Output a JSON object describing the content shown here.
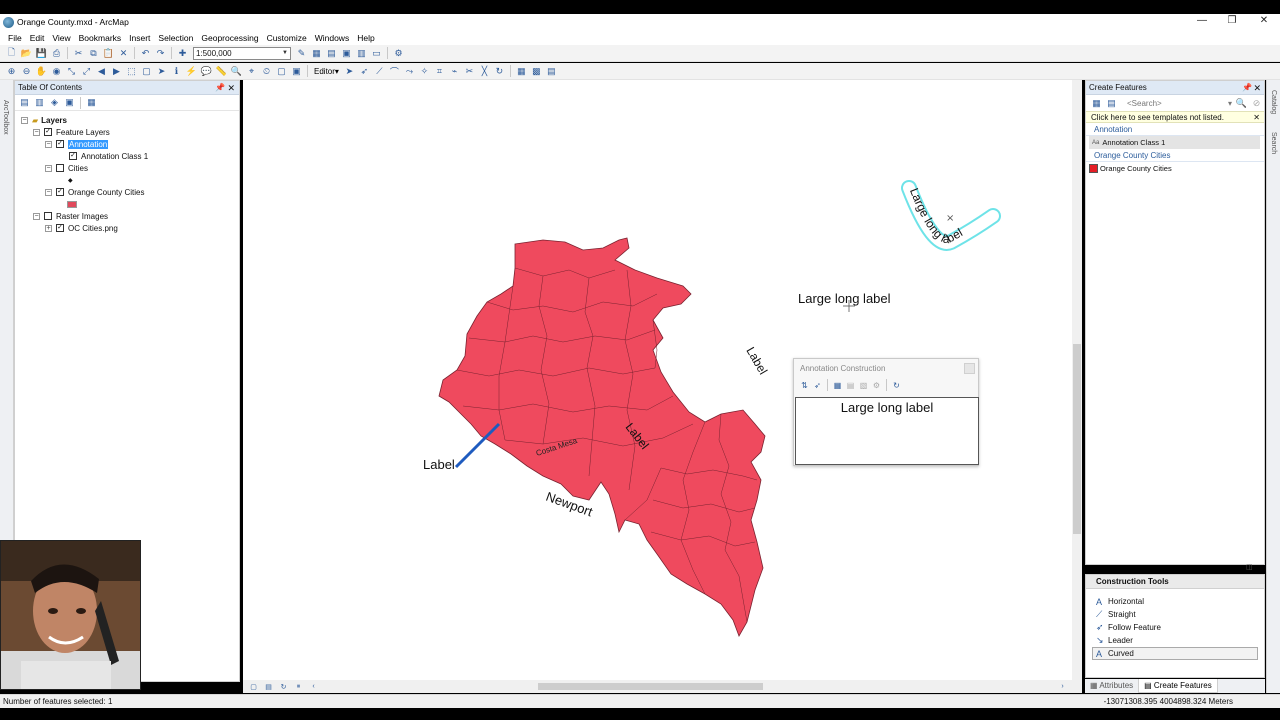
{
  "window": {
    "title": "Orange County.mxd - ArcMap"
  },
  "menu": [
    "File",
    "Edit",
    "View",
    "Bookmarks",
    "Insert",
    "Selection",
    "Geoprocessing",
    "Customize",
    "Windows",
    "Help"
  ],
  "toolbar": {
    "scale": "1:500,000",
    "editor_label": "Editor"
  },
  "left_strip": {
    "label": "ArcToolbox"
  },
  "toc": {
    "title": "Table Of Contents",
    "layers_root": "Layers",
    "feature_layers": "Feature Layers",
    "annotation": "Annotation",
    "annotation_class": "Annotation Class 1",
    "cities": "Cities",
    "oc_cities": "Orange County Cities",
    "raster_images": "Raster Images",
    "oc_png": "OC Cities.png"
  },
  "map": {
    "labels": {
      "large_long_label": "Large long label",
      "curved_label": "Large long label",
      "label_left": "Label",
      "label_rotated": "Label",
      "label_right": "Label",
      "costa_mesa": "Costa Mesa",
      "newport": "Newport"
    },
    "colors": {
      "polygon_fill": "#ef4a5e",
      "polygon_stroke": "#7a2230",
      "leader_line": "#1e5bbf",
      "selection_halo": "#5ee0e6"
    }
  },
  "annotation_dialog": {
    "title": "Annotation Construction",
    "text": "Large long label"
  },
  "create_features": {
    "title": "Create Features",
    "search_placeholder": "<Search>",
    "warning": "Click here to see templates not listed.",
    "groups": [
      {
        "name": "Annotation",
        "items": [
          "Annotation Class 1"
        ]
      },
      {
        "name": "Orange County Cities",
        "items": [
          "Orange County Cities"
        ]
      }
    ]
  },
  "construction_tools": {
    "title": "Construction Tools",
    "items": [
      "Horizontal",
      "Straight",
      "Follow Feature",
      "Leader",
      "Curved"
    ],
    "selected": "Curved"
  },
  "right_tabs": {
    "attributes": "Attributes",
    "create_features": "Create Features"
  },
  "right_strip": {
    "catalog": "Catalog",
    "search": "Search"
  },
  "status": {
    "selection": "Number of features selected: 1",
    "coords": "-13071308.395  4004898.324 Meters"
  }
}
